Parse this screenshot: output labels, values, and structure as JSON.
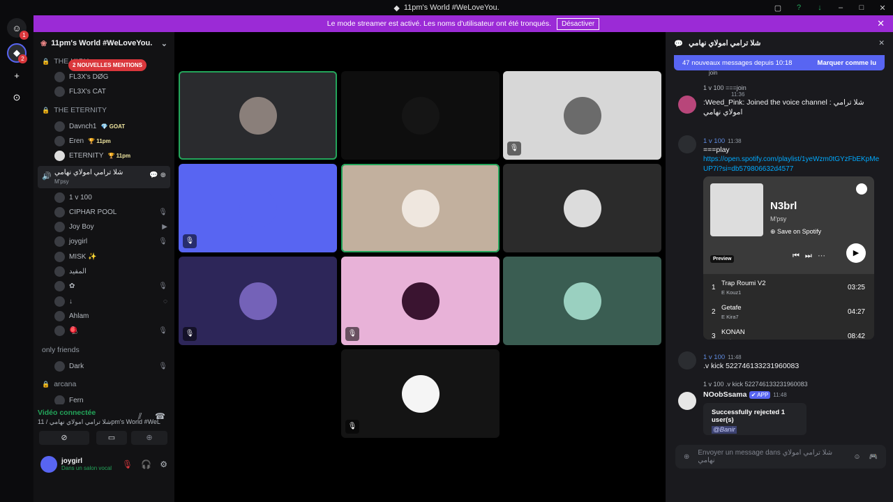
{
  "window": {
    "title": "11pm's World #WeLoveYou.",
    "controls": [
      "▢",
      "?",
      "↓",
      "–",
      "□",
      "✕"
    ]
  },
  "banner": {
    "text": "Le mode streamer est activé. Les noms d'utilisateur ont été tronqués.",
    "button": "Désactiver",
    "close": "✕"
  },
  "rail": {
    "home_badge": "1",
    "server_badge": "2",
    "add": "+",
    "explore": "⊙"
  },
  "sidebar": {
    "server_name": "11pm's World #WeLoveYou.",
    "mentions": "2 NOUVELLES MENTIONS",
    "categories": {
      "the_high": "THE HIGH",
      "eternity": "THE ETERNITY",
      "only_friends": "only friends",
      "arcana": "arcana"
    },
    "high_users": [
      "FL3X's DØG",
      "FL3X's CAT"
    ],
    "eternity_users": [
      {
        "name": "Davnch1",
        "tag": "💎 GOAT"
      },
      {
        "name": "Eren",
        "tag": "🏆 11pm"
      },
      {
        "name": "ETERNITY",
        "tag": "🏆 11pm"
      }
    ],
    "voice_channel": {
      "name": "شلا ترامي امولاي نهامي",
      "sub": "M'psy"
    },
    "voice_users": [
      {
        "name": "1 v 100",
        "icon": ""
      },
      {
        "name": "CIPHAR POOL",
        "icon": "🎙"
      },
      {
        "name": "Joy Boy",
        "icon": "▶"
      },
      {
        "name": "joygirl",
        "icon": "🎙"
      },
      {
        "name": "MISK ✨",
        "icon": ""
      },
      {
        "name": "المفيد",
        "icon": ""
      },
      {
        "name": "✿",
        "icon": "🎙"
      },
      {
        "name": "↓",
        "icon": "◌"
      },
      {
        "name": "Ahlam",
        "icon": ""
      },
      {
        "name": "🪀",
        "icon": "🎙"
      }
    ],
    "friends_users": [
      {
        "name": "Dark",
        "icon": "🎙"
      }
    ],
    "arcana_users": [
      {
        "name": "Fern"
      }
    ]
  },
  "voice_panel": {
    "status": "Vidéo connectée",
    "channel": "شلا ترامي امولاي نهامي / 11pm's World #WeLov...",
    "buttons": [
      "⊘",
      "▭",
      "⊕"
    ]
  },
  "user_panel": {
    "name": "joygirl",
    "status": "Dans un salon vocal"
  },
  "tiles": [
    {
      "bg": "#2a2b2e",
      "speaking": true,
      "avatar": "#8a7f7a",
      "muted": false
    },
    {
      "bg": "#0e0e0e",
      "speaking": false,
      "avatar": "#151515",
      "muted": false
    },
    {
      "bg": "#d7d7d7",
      "speaking": false,
      "avatar": "#6b6b6b",
      "muted": true
    },
    {
      "bg": "#5865f2",
      "speaking": false,
      "avatar": "#5865f2",
      "muted": true
    },
    {
      "bg": "#c2b09e",
      "speaking": true,
      "avatar": "#efe7df",
      "muted": false
    },
    {
      "bg": "#2b2b2b",
      "speaking": false,
      "avatar": "#dcdcdc",
      "muted": false
    },
    {
      "bg": "#2d2659",
      "speaking": false,
      "avatar": "#7462b8",
      "muted": true
    },
    {
      "bg": "#e8b2d8",
      "speaking": false,
      "avatar": "#3a1430",
      "muted": true
    },
    {
      "bg": "#3a5d52",
      "speaking": false,
      "avatar": "#9ad0c0",
      "muted": false
    },
    {
      "bg": "#141414",
      "speaking": false,
      "avatar": "#f5f5f5",
      "muted": true
    }
  ],
  "chat": {
    "title": "شلا ترامي امولاي نهامي",
    "new_messages": "47 nouveaux messages depuis 10:18",
    "mark_read": "Marquer comme lu",
    "partial": "join",
    "messages": [
      {
        "reply": "1 v 100 ===join",
        "time": "11:36",
        "text": ":Weed_Pink: Joined the voice channel : شلا ترامي امولاي نهامي"
      },
      {
        "name": "1 v 100",
        "time": "11:38",
        "text": "===play",
        "link": "https://open.spotify.com/playlist/1yeWzm0tGYzFbEKpMeUP7i?si=db579806632d4577"
      },
      {
        "name": "1 v 100",
        "time": "11:48",
        "text": ".v kick 522746133231960083"
      },
      {
        "reply": "1 v 100 .v kick 522746133231960083",
        "name": "NOobSsama",
        "badge": "✔ APP",
        "time": "11:48"
      }
    ],
    "spotify": {
      "title": "N3brl",
      "artist": "M'psy",
      "save": "Save on Spotify",
      "preview": "Preview",
      "tracks": [
        {
          "n": "1",
          "title": "Trap Roumi V2",
          "artist": "E  Kouz1",
          "dur": "03:25"
        },
        {
          "n": "2",
          "title": "Getafe",
          "artist": "E  Kira7",
          "dur": "04:27"
        },
        {
          "n": "3",
          "title": "KONAN",
          "artist": "E  Kira7",
          "dur": "08:42"
        }
      ]
    },
    "rejected": {
      "text": "Successfully rejected 1 user(s)",
      "mention": "@Banir"
    },
    "input_placeholder": "Envoyer un message dans شلا ترامي امولاي نهامي"
  }
}
